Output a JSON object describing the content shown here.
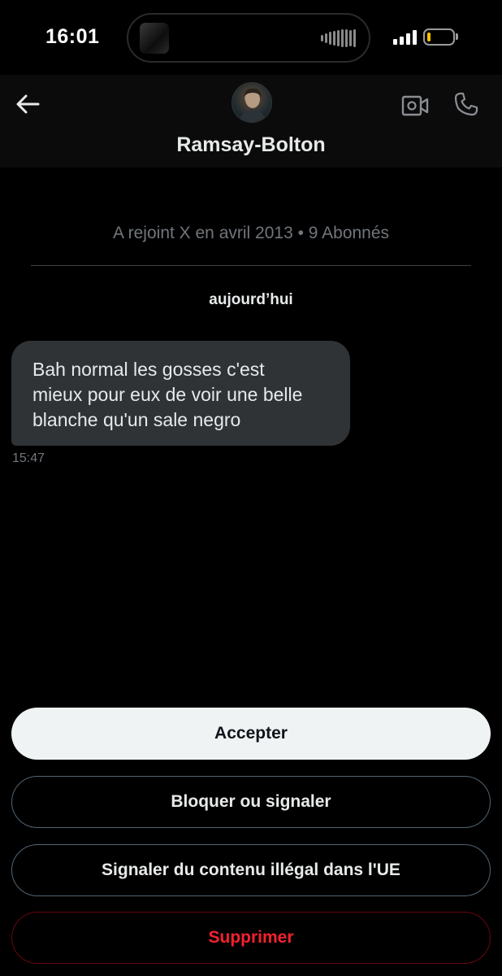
{
  "status_bar": {
    "time": "16:01",
    "icons": [
      "dynamic-island",
      "audio-waveform-icon",
      "cellular-signal-icon",
      "battery-icon"
    ],
    "battery_level_fraction": 0.12,
    "battery_color": "#f5c400"
  },
  "header": {
    "back_icon": "arrow-left-icon",
    "username": "Ramsay-Bolton",
    "video_icon": "video-call-icon",
    "call_icon": "phone-icon"
  },
  "conversation": {
    "join_info": "A rejoint X en avril 2013 • 9 Abonnés",
    "day_label": "aujourd’hui",
    "messages": [
      {
        "lines": [
          "Bah normal les gosses c'est",
          "mieux pour eux de voir une belle",
          "blanche qu'un sale negro"
        ],
        "time": "15:47"
      }
    ]
  },
  "actions": {
    "accept": "Accepter",
    "block": "Bloquer ou signaler",
    "report": "Signaler du contenu illégal dans l'UE",
    "delete": "Supprimer"
  },
  "colors": {
    "background": "#000000",
    "bubble": "#2f3336",
    "muted_text": "#71767b",
    "danger": "#f4212e",
    "accept_bg": "#eff3f4"
  }
}
